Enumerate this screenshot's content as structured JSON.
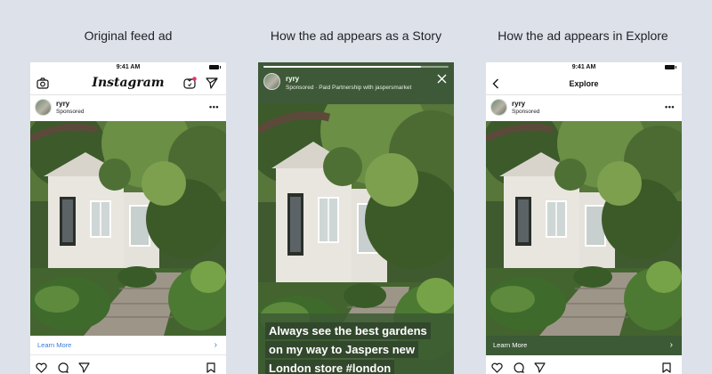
{
  "captions": {
    "feed": "Original feed ad",
    "story": "How the ad appears as a Story",
    "explore": "How the ad appears in Explore"
  },
  "status": {
    "time": "9:41 AM"
  },
  "feed": {
    "logo": "Instagram",
    "username": "ryry",
    "sponsored": "Sponsored",
    "more": "•••",
    "cta": "Learn More"
  },
  "story": {
    "username": "ryry",
    "subtitle": "Sponsored · Paid Partnership with jaspersmarket",
    "progress": 0.85,
    "text_lines": [
      "Always see the best gardens",
      "on my way to Jaspers new",
      "London store #london"
    ]
  },
  "explore": {
    "title": "Explore",
    "username": "ryry",
    "sponsored": "Sponsored",
    "more": "•••",
    "cta": "Learn More"
  },
  "colors": {
    "background": "#dde1ea",
    "story_green": "#3e5938",
    "link_blue": "#3a7bd5",
    "explore_cta": "#3b5a35"
  },
  "icons": [
    "camera-icon",
    "igtv-icon",
    "send-icon",
    "back-icon",
    "close-icon",
    "heart-icon",
    "comment-icon",
    "share-icon",
    "bookmark-icon",
    "chevron-right-icon"
  ]
}
